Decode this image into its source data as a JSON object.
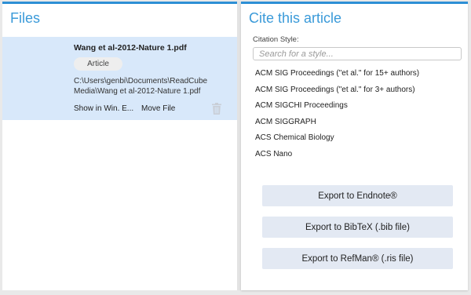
{
  "files": {
    "title": "Files",
    "file": {
      "name": "Wang et al-2012-Nature 1.pdf",
      "type": "Article",
      "path": "C:\\Users\\genbi\\Documents\\ReadCube Media\\Wang et al-2012-Nature 1.pdf",
      "show_in_label": "Show in Win. E...",
      "move_label": "Move File"
    },
    "icons": {
      "delete": "trash-icon"
    }
  },
  "cite": {
    "title": "Cite this article",
    "style_label": "Citation Style:",
    "search_placeholder": "Search for a style...",
    "styles": [
      "ACM SIG Proceedings (\"et al.\" for 15+ authors)",
      "ACM SIG Proceedings (\"et al.\" for 3+ authors)",
      "ACM SIGCHI Proceedings",
      "ACM SIGGRAPH",
      "ACS Chemical Biology",
      "ACS Nano"
    ],
    "export_endnote": "Export to Endnote®",
    "export_bibtex": "Export to BibTeX (.bib file)",
    "export_refman": "Export to RefMan® (.ris file)"
  },
  "colors": {
    "accent": "#2d8fd5",
    "title_text": "#3a9ad9",
    "selected_row": "#d8e8fa",
    "button_bg": "#e3e9f3"
  }
}
